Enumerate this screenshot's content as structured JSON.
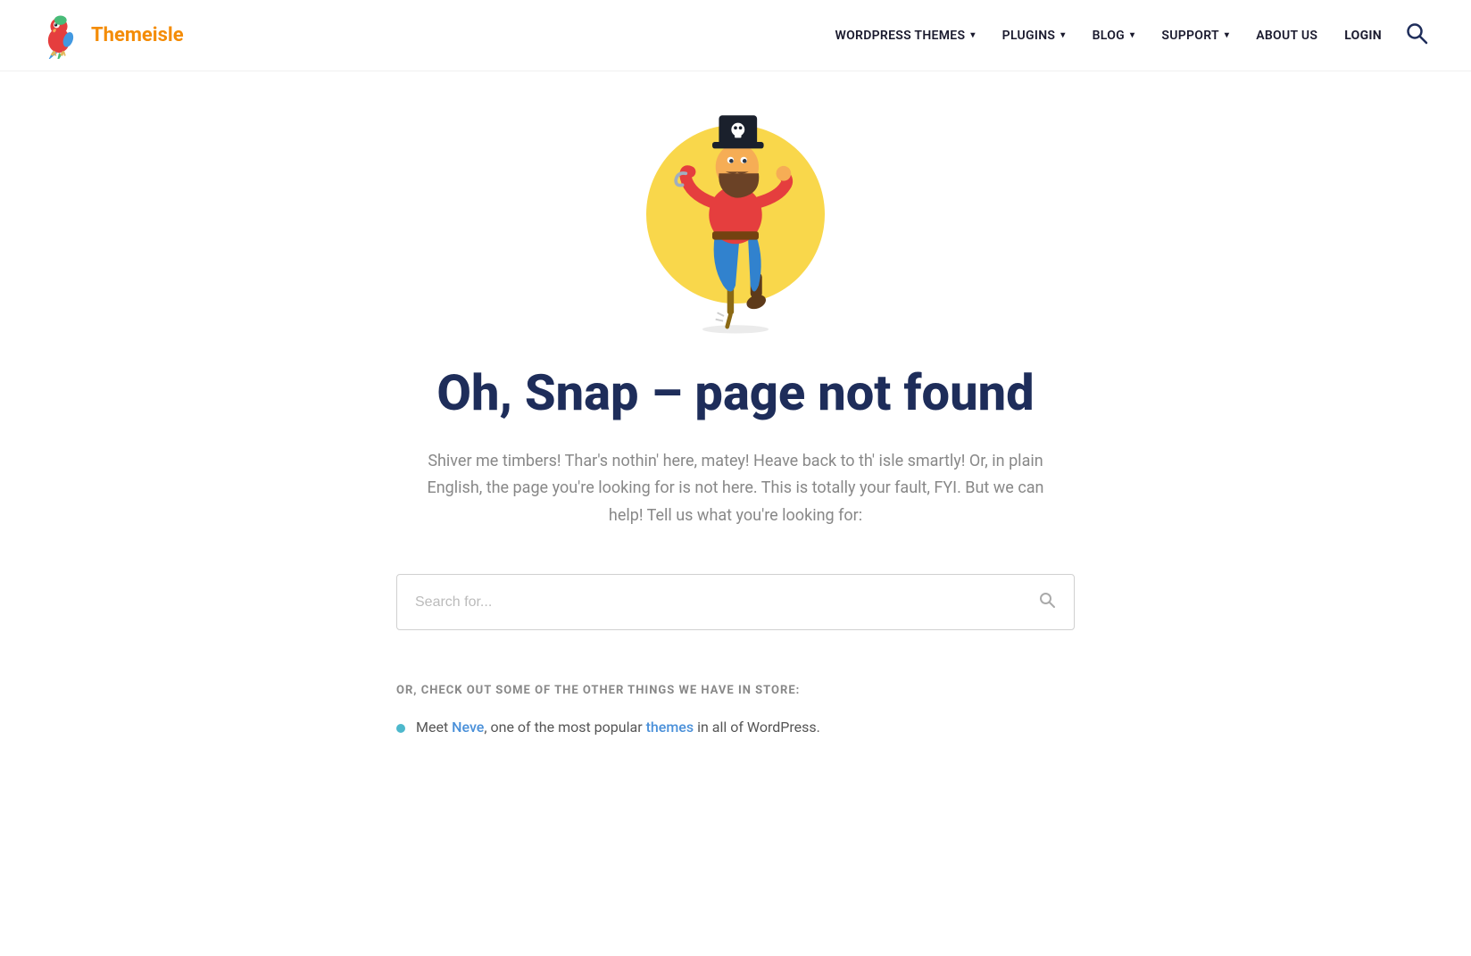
{
  "header": {
    "logo_text_main": "Theme",
    "logo_text_accent": "isle",
    "nav": {
      "items": [
        {
          "id": "wordpress-themes",
          "label": "WORDPRESS THEMES",
          "has_dropdown": true
        },
        {
          "id": "plugins",
          "label": "PLUGINS",
          "has_dropdown": true
        },
        {
          "id": "blog",
          "label": "BLOG",
          "has_dropdown": true
        },
        {
          "id": "support",
          "label": "SUPPORT",
          "has_dropdown": true
        },
        {
          "id": "about-us",
          "label": "ABOUT US",
          "has_dropdown": false
        },
        {
          "id": "login",
          "label": "LOGIN",
          "has_dropdown": false
        }
      ]
    }
  },
  "main": {
    "error_heading": "Oh, Snap – page not found",
    "description": "Shiver me timbers! Thar's nothin' here, matey! Heave back to th' isle smartly! Or, in plain English, the page you're looking for is not here. This is totally your fault, FYI. But we can help! Tell us what you're looking for:",
    "search_placeholder": "Search for...",
    "checkout_label": "OR, CHECK OUT SOME OF THE OTHER THINGS WE HAVE IN STORE:",
    "checkout_items": [
      {
        "text_before": "Meet ",
        "link1_text": "Neve",
        "link1_href": "#",
        "text_middle": ", one of the most popular ",
        "link2_text": "themes",
        "link2_href": "#",
        "text_after": " in all of WordPress."
      }
    ]
  }
}
